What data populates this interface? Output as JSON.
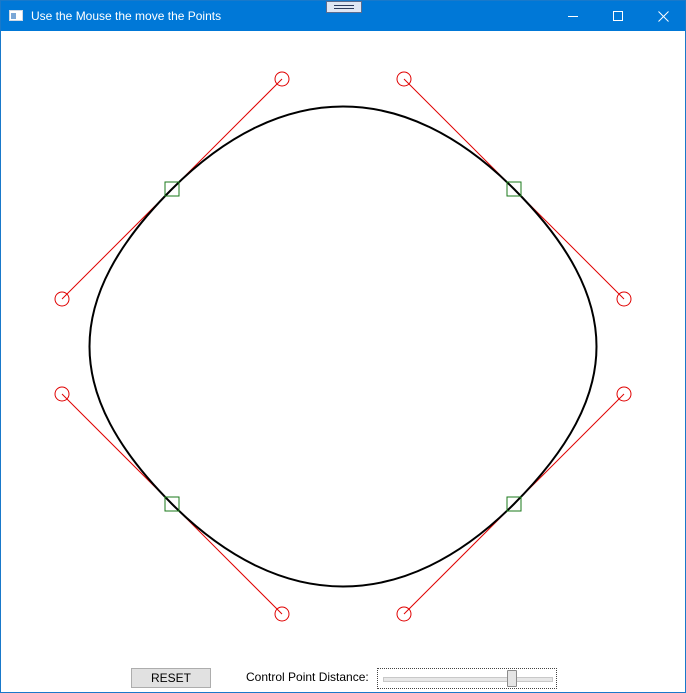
{
  "window": {
    "title": "Use the Mouse the move the Points",
    "icons": {
      "app": "app-window-icon",
      "minimize": "minimize-icon",
      "maximize": "maximize-icon",
      "close": "close-icon"
    }
  },
  "controls": {
    "reset_label": "RESET",
    "distance_label": "Control Point Distance:",
    "slider_value": 0.76
  },
  "colors": {
    "titlebar": "#0078d7",
    "curve": "#000000",
    "control_point": "#e00000",
    "anchor_point": "#1a7a1a"
  }
}
